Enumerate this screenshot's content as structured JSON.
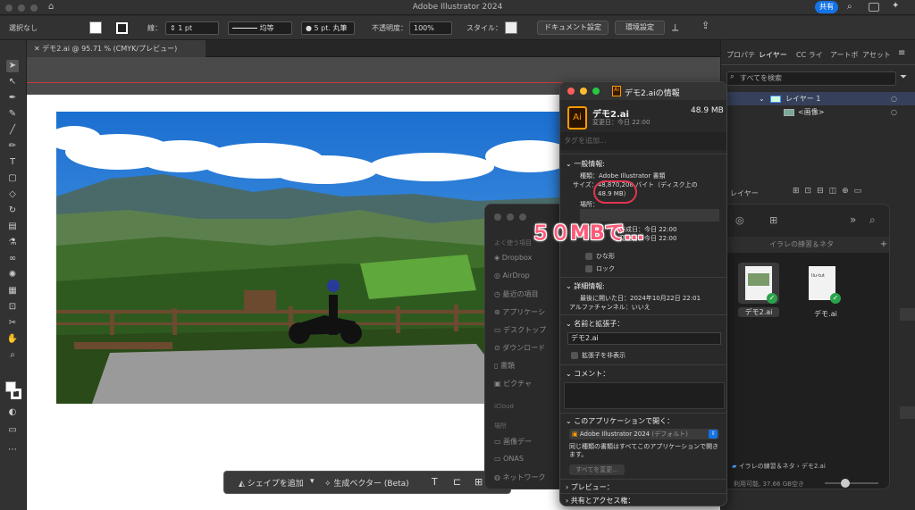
{
  "app": {
    "title": "Adobe Illustrator 2024",
    "share": "共有"
  },
  "control_bar": {
    "selection": "選択なし",
    "stroke_label": "線：",
    "stroke_value": "1 pt",
    "stroke_style": "均等",
    "brush": "5 pt. 丸筆",
    "opacity_label": "不透明度：",
    "opacity_value": "100%",
    "style_label": "スタイル：",
    "doc_settings": "ドキュメント設定",
    "prefs": "環境設定"
  },
  "doc_tab": {
    "label": "デモ2.ai @ 95.71 % (CMYK/プレビュー)"
  },
  "context_bar": {
    "add_shape": "シェイプを追加",
    "gen_vector": "生成ベクター (Beta)"
  },
  "panel": {
    "tabs": [
      "プロパテ",
      "レイヤー",
      "CC ライ",
      "アートボ",
      "アセット"
    ],
    "search_placeholder": "すべてを検索",
    "layers": [
      {
        "name": "レイヤー 1"
      },
      {
        "name": "<画像>"
      }
    ],
    "footer_label": "レイヤー"
  },
  "finder": {
    "sidebar_head": "よく使う項目",
    "sidebar": [
      "Dropbox",
      "AirDrop",
      "最近の項目",
      "アプリケーシ",
      "デスクトップ",
      "ダウンロード",
      "書類",
      "ピクチャ"
    ],
    "icloud": "iCloud",
    "places_head": "場所",
    "places": [
      "画像デー",
      "ONAS",
      "ネットワーク"
    ],
    "folder_tab": "イラレの練習＆ネタ",
    "files": [
      {
        "name": "デモ2.ai"
      },
      {
        "name": "デモ.ai"
      }
    ],
    "path": [
      "イラレの練習＆ネタ",
      "デモ2.ai"
    ],
    "status": "利用可能, 37.66 GB空き"
  },
  "info": {
    "title": "デモ2.aiの情報",
    "file_name": "デモ2.ai",
    "file_size": "48.9 MB",
    "modified": "変更日：今日 22:00",
    "tags_placeholder": "タグを追加...",
    "general_head": "一般情報:",
    "kind": "種類：Adobe Illustrator 書類",
    "size_line": "サイズ：48,870,208 バイト（ディスク上の",
    "size_disk": "48.9 MB）",
    "location": "場所：",
    "created": "作成日：今日 22:00",
    "modified2": "変更日：今日 22:00",
    "stationery": "ひな形",
    "locked": "ロック",
    "detail_head": "詳細情報:",
    "last_opened": "最後に開いた日：2024年10月22日 22:01",
    "alpha": "アルファチャンネル：いいえ",
    "name_ext_head": "名前と拡張子：",
    "name_value": "デモ2.ai",
    "hide_ext": "拡張子を非表示",
    "comments_head": "コメント：",
    "open_with_head": "このアプリケーションで開く：",
    "open_with_value": "Adobe Illustrator 2024",
    "open_with_default": "(デフォルト)",
    "open_with_note": "同じ種類の書類はすべてこのアプリケーションで開きます。",
    "change_all": "すべてを変更...",
    "preview_head": "プレビュー：",
    "sharing_head": "共有とアクセス権："
  },
  "annotation": {
    "text": "５０MBで…"
  }
}
